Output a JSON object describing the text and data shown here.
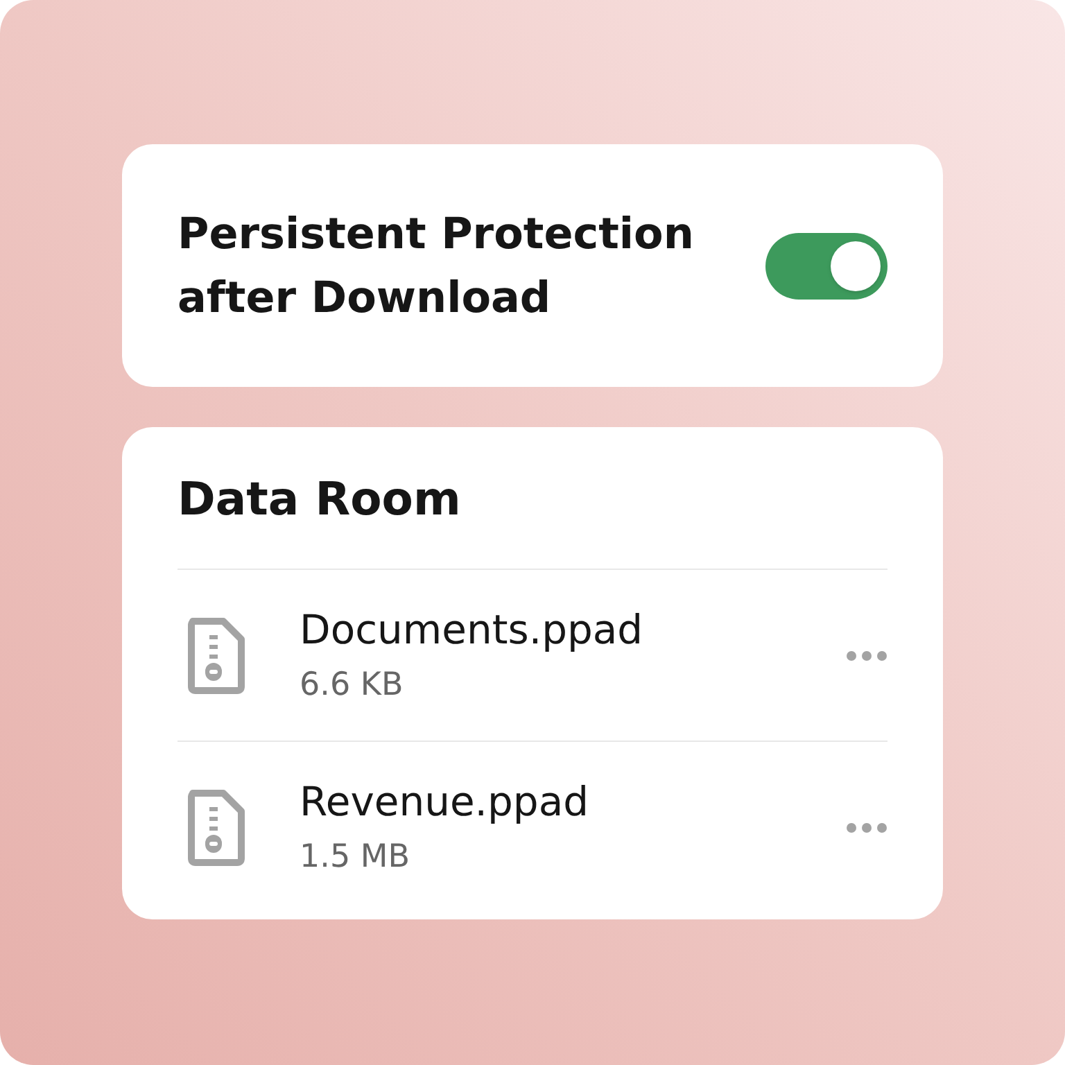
{
  "setting": {
    "label": "Persistent Protection after Download",
    "on": true
  },
  "data_room": {
    "title": "Data Room",
    "files": [
      {
        "name": "Documents.ppad",
        "size": "6.6 KB"
      },
      {
        "name": "Revenue.ppad",
        "size": "1.5 MB"
      }
    ]
  }
}
